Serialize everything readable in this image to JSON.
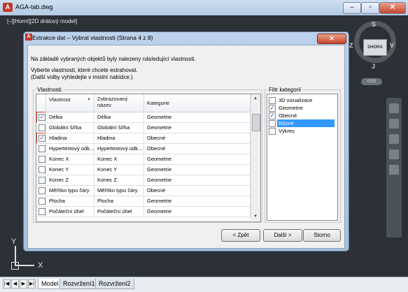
{
  "app": {
    "title": "AGA-tab.dwg",
    "logo": "A"
  },
  "window_controls": {
    "minimize": "–",
    "maximize": "▫",
    "close": "✕"
  },
  "viewport": {
    "label": "[–][Horní][2D drátový model]"
  },
  "viewcube": {
    "top_face": "SHORA",
    "north": "S",
    "south": "J",
    "east": "V",
    "west": "Z",
    "wcs_button": "GSS"
  },
  "ucs": {
    "y": "Y",
    "x": "X"
  },
  "layout_tabs": {
    "nav": [
      "|◀",
      "◀",
      "▶",
      "▶|"
    ],
    "tabs": [
      "Model",
      "Rozvržení1",
      "Rozvržení2"
    ]
  },
  "dialog": {
    "icon": "A",
    "title": "Extrakce dat – Vybrat vlastnosti (Strana 4 z 8)",
    "close": "✕",
    "intro": "Na základě vybraných objektů byly nalezeny následující vlastnosti.",
    "instruction_1": "Vyberte vlastnosti, které chcete extrahovat.",
    "instruction_2": "(Další volby vyhledejte v místní nabídce.)",
    "properties_group_label": "Vlastnosti",
    "columns": {
      "property": "Vlastnost",
      "sort_indicator": "▲",
      "display_name": "Zobrazovaný\nnázev",
      "category": "Kategorie"
    },
    "rows": [
      {
        "checked": true,
        "property": "Délka",
        "display_name": "Délka",
        "category": "Geometrie",
        "highlighted": true
      },
      {
        "checked": false,
        "property": "Globální šířka",
        "display_name": "Globální šířka",
        "category": "Geometrie"
      },
      {
        "checked": true,
        "property": "Hladina",
        "display_name": "Hladina",
        "category": "Obecné",
        "highlighted": true
      },
      {
        "checked": false,
        "property": "Hypertextový odk...",
        "display_name": "Hypertextový odk...",
        "category": "Obecné"
      },
      {
        "checked": false,
        "property": "Konec X",
        "display_name": "Konec X",
        "category": "Geometrie"
      },
      {
        "checked": false,
        "property": "Konec Y",
        "display_name": "Konec Y",
        "category": "Geometrie"
      },
      {
        "checked": false,
        "property": "Konec Z",
        "display_name": "Konec Z",
        "category": "Geometrie"
      },
      {
        "checked": false,
        "property": "Měřítko typu čáry",
        "display_name": "Měřítko typu čáry",
        "category": "Obecné"
      },
      {
        "checked": false,
        "property": "Plocha",
        "display_name": "Plocha",
        "category": "Geometrie"
      },
      {
        "checked": false,
        "property": "Počáteční úhel",
        "display_name": "Počáteční úhel",
        "category": "Geometrie"
      }
    ],
    "filter_group_label": "Filtr kategorií",
    "categories": [
      {
        "label": "3D vizualizace",
        "checked": false,
        "selected": false
      },
      {
        "label": "Geometrie",
        "checked": true,
        "selected": false
      },
      {
        "label": "Obecné",
        "checked": true,
        "selected": false
      },
      {
        "label": "Různé",
        "checked": false,
        "selected": true
      },
      {
        "label": "Výkres",
        "checked": false,
        "selected": false
      }
    ],
    "buttons": {
      "back": "< Zpět",
      "next": "Další >",
      "cancel": "Storno"
    }
  },
  "colors": {
    "highlight_outline": "#d33b2a",
    "selection": "#3399ff",
    "drawing_bg": "#2b3137"
  }
}
